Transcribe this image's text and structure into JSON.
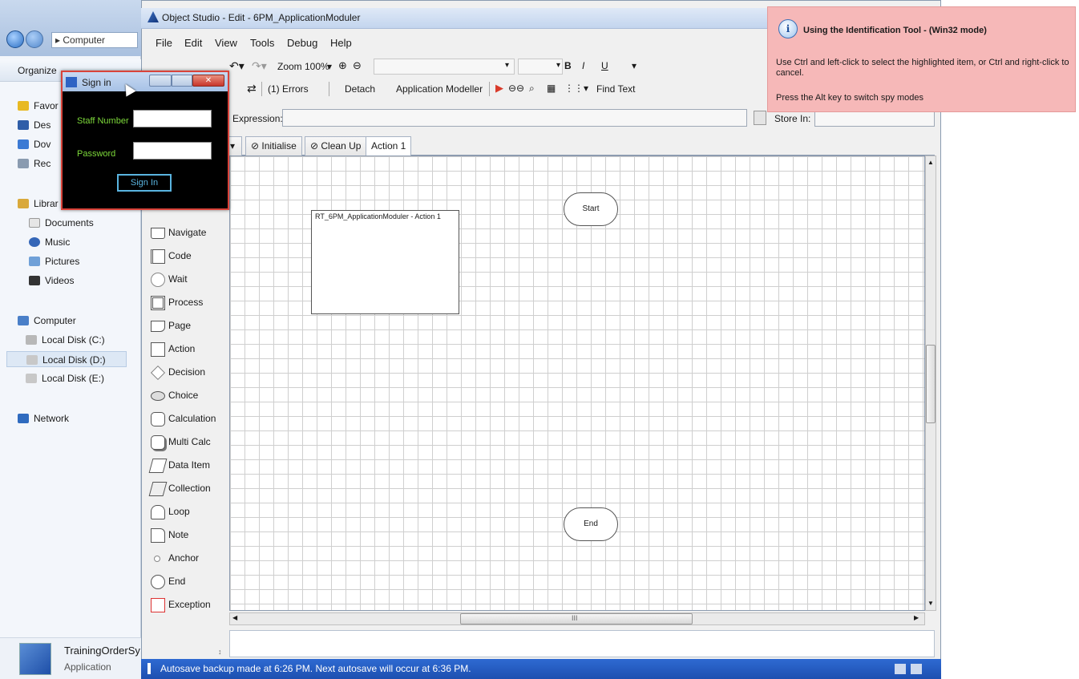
{
  "explorer": {
    "path": "▸ Computer",
    "organize": "Organize",
    "favorites": [
      {
        "label": "Favor",
        "icon": "star-icon",
        "color": "#e8b923"
      },
      {
        "label": "Des",
        "icon": "desktop-icon",
        "color": "#2f5ea8"
      },
      {
        "label": "Dov",
        "icon": "downloads-icon",
        "color": "#3c7ad4"
      },
      {
        "label": "Rec",
        "icon": "recent-icon",
        "color": "#8a9bb0"
      }
    ],
    "libraries_label": "Librar",
    "libraries": [
      "Documents",
      "Music",
      "Pictures",
      "Videos"
    ],
    "computer_label": "Computer",
    "drives": [
      "Local Disk (C:)",
      "Local Disk (D:)",
      "Local Disk (E:)"
    ],
    "network_label": "Network",
    "task": {
      "name": "TrainingOrderSy",
      "type": "Application"
    }
  },
  "studio": {
    "title": "Object Studio - Edit -     6PM_ApplicationModuler",
    "menus": [
      "File",
      "Edit",
      "View",
      "Tools",
      "Debug",
      "Help"
    ],
    "zoom": "Zoom 100%",
    "font_style": [
      "B",
      "I",
      "U"
    ],
    "toolbar2": {
      "errors": "(1) Errors",
      "detach": "Detach",
      "app_modeller": "Application Modeller",
      "find_text": "Find Text"
    },
    "expression_label": "Expression:",
    "store_in_label": "Store In:",
    "tabs": [
      "Initialise",
      "Clean Up",
      "Action 1"
    ],
    "palette": [
      "Navigate",
      "Code",
      "Wait",
      "Process",
      "Page",
      "Action",
      "Decision",
      "Choice",
      "Calculation",
      "Multi Calc",
      "Data Item",
      "Collection",
      "Loop",
      "Note",
      "Anchor",
      "End",
      "Exception"
    ],
    "start_label": "Start",
    "end_label": "End",
    "page_box_label": "RT_6PM_ApplicationModuler - Action 1",
    "hscroll_grip": "III",
    "status": "Autosave backup made at 6:26 PM. Next autosave will occur at 6:36 PM."
  },
  "signin": {
    "title": "Sign in",
    "staff_label": "Staff Number",
    "password_label": "Password",
    "button": "Sign In"
  },
  "tooltip": {
    "title": "Using the Identification Tool - (Win32 mode)",
    "line1": "Use Ctrl and left-click to select the highlighted item, or Ctrl and right-click to cancel.",
    "line2": "Press the Alt key to switch spy modes"
  }
}
